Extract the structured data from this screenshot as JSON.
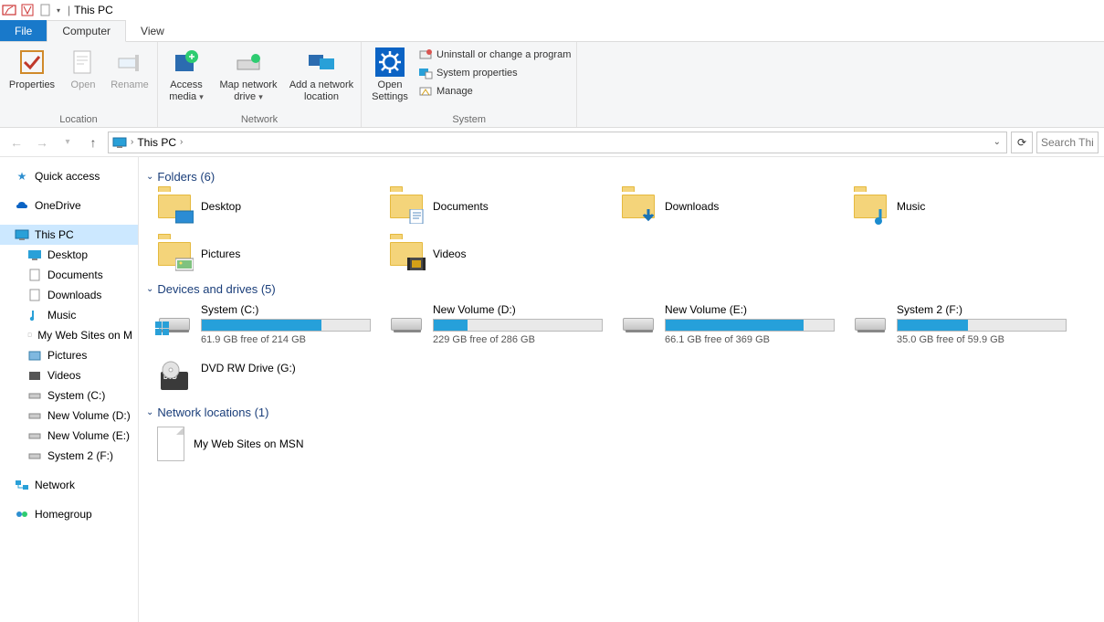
{
  "title": "This PC",
  "tabs": {
    "file": "File",
    "computer": "Computer",
    "view": "View"
  },
  "ribbon": {
    "location": {
      "label": "Location",
      "properties": "Properties",
      "open": "Open",
      "rename": "Rename"
    },
    "network": {
      "label": "Network",
      "access_media": "Access media",
      "map_drive": "Map network drive",
      "add_location": "Add a network location"
    },
    "open_settings": "Open Settings",
    "system": {
      "label": "System",
      "uninstall": "Uninstall or change a program",
      "properties": "System properties",
      "manage": "Manage"
    }
  },
  "address": {
    "crumb": "This PC",
    "search_placeholder": "Search Thi"
  },
  "sidebar": {
    "quick_access": "Quick access",
    "onedrive": "OneDrive",
    "this_pc": "This PC",
    "children": [
      "Desktop",
      "Documents",
      "Downloads",
      "Music",
      "My Web Sites on M",
      "Pictures",
      "Videos",
      "System (C:)",
      "New Volume (D:)",
      "New Volume (E:)",
      "System 2 (F:)"
    ],
    "network": "Network",
    "homegroup": "Homegroup"
  },
  "sections": {
    "folders": {
      "header": "Folders (6)",
      "items": [
        "Desktop",
        "Documents",
        "Downloads",
        "Music",
        "Pictures",
        "Videos"
      ]
    },
    "drives": {
      "header": "Devices and drives (5)",
      "items": [
        {
          "name": "System (C:)",
          "free_text": "61.9 GB free of 214 GB",
          "fill_pct": 71
        },
        {
          "name": "New Volume (D:)",
          "free_text": "229 GB free of 286 GB",
          "fill_pct": 20
        },
        {
          "name": "New Volume (E:)",
          "free_text": "66.1 GB free of 369 GB",
          "fill_pct": 82
        },
        {
          "name": "System 2 (F:)",
          "free_text": "35.0 GB free of 59.9 GB",
          "fill_pct": 42
        },
        {
          "name": "DVD RW Drive (G:)",
          "type": "dvd"
        }
      ]
    },
    "network": {
      "header": "Network locations (1)",
      "items": [
        "My Web Sites on MSN"
      ]
    }
  }
}
